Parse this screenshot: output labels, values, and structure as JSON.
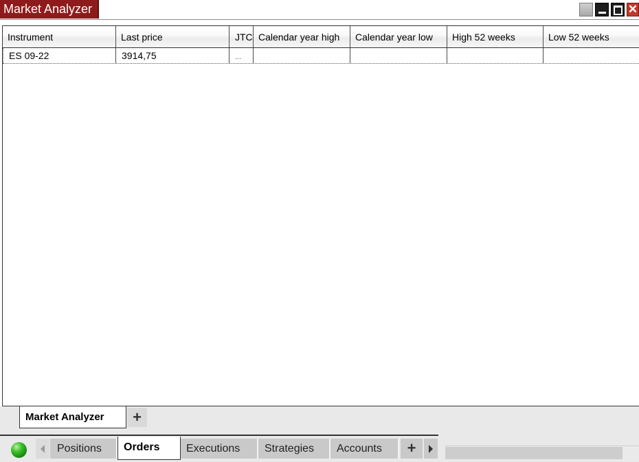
{
  "window": {
    "title": "Market Analyzer",
    "controls": [
      "gray-icon",
      "minimize-icon",
      "maximize-icon",
      "close-icon"
    ],
    "close_glyph": "✕"
  },
  "grid": {
    "columns": [
      {
        "label": "Instrument"
      },
      {
        "label": "Last price"
      },
      {
        "label": "JTC"
      },
      {
        "label": "Calendar year high"
      },
      {
        "label": "Calendar year low"
      },
      {
        "label": "High 52 weeks"
      },
      {
        "label": "Low 52 weeks"
      }
    ],
    "rows": [
      {
        "cells": [
          "ES 09-22",
          "3914,75",
          "...",
          "",
          "",
          "",
          ""
        ]
      }
    ]
  },
  "inner_tabs": {
    "active": "Market Analyzer",
    "add_label": "+"
  },
  "bottom_tabs": {
    "items": [
      "Positions",
      "Orders",
      "Executions",
      "Strategies",
      "Accounts"
    ],
    "active": "Orders",
    "add_label": "+"
  },
  "colors": {
    "title_bg": "#8e1b1b",
    "status": "#3cbf2a",
    "close": "#c0392b"
  }
}
